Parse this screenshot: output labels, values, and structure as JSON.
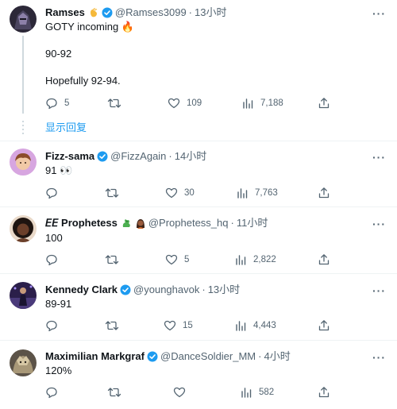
{
  "tweets": [
    {
      "name": "Ramses",
      "handle": "@Ramses3099",
      "time": "13小时",
      "lines": [
        "GOTY incoming 🔥",
        "90-92",
        "Hopefully 92-94."
      ],
      "stats": {
        "replies": "5",
        "retweets": "",
        "likes": "109",
        "views": "7,188"
      },
      "name_emoji": "clap-hands-icon",
      "avatar_color": "#2c2838"
    },
    {
      "name": "Fizz-sama",
      "handle": "@FizzAgain",
      "time": "14小时",
      "lines": [
        "91 👀"
      ],
      "stats": {
        "replies": "",
        "retweets": "",
        "likes": "30",
        "views": "7,763"
      },
      "avatar_color": "#c98bd6"
    },
    {
      "name": "𝘌𝘌 Prophetess",
      "handle": "@Prophetess_hq",
      "time": "11小时",
      "lines": [
        "100"
      ],
      "stats": {
        "replies": "",
        "retweets": "",
        "likes": "5",
        "views": "2,822"
      },
      "avatar_color": "#5a3a2a"
    },
    {
      "name": "Kennedy Clark",
      "handle": "@younghavok",
      "time": "13小时",
      "lines": [
        "89-91"
      ],
      "stats": {
        "replies": "",
        "retweets": "",
        "likes": "15",
        "views": "4,443"
      },
      "avatar_color": "#3b2a5e"
    },
    {
      "name": "Maximilian Markgraf",
      "handle": "@DanceSoldier_MM",
      "time": "4小时",
      "lines": [
        "120%"
      ],
      "stats": {
        "replies": "",
        "retweets": "",
        "likes": "",
        "views": "582"
      },
      "avatar_color": "#7a6a55"
    }
  ],
  "show_replies": "显示回复",
  "colors": {
    "verified": "#1d9bf0",
    "muted": "#536471",
    "link": "#1d9bf0"
  }
}
